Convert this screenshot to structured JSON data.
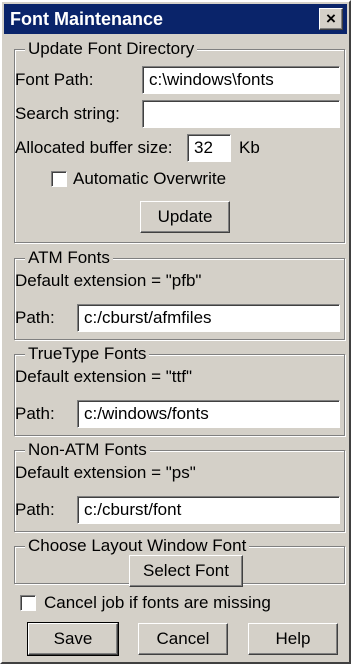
{
  "window": {
    "title": "Font Maintenance",
    "close_label": "×"
  },
  "update_group": {
    "legend": "Update Font Directory",
    "font_path_label": "Font Path:",
    "font_path_value": "c:\\windows\\fonts",
    "search_label": "Search string:",
    "search_value": "",
    "buffer_label": "Allocated buffer size:",
    "buffer_value": "32",
    "buffer_unit": "Kb",
    "auto_overwrite_label": "Automatic Overwrite",
    "auto_overwrite_checked": false,
    "update_button": "Update"
  },
  "atm_group": {
    "legend": "ATM Fonts",
    "default_ext": "Default extension = \"pfb\"",
    "path_label": "Path:",
    "path_value": "c:/cburst/afmfiles"
  },
  "truetype_group": {
    "legend": "TrueType Fonts",
    "default_ext": "Default extension = \"ttf\"",
    "path_label": "Path:",
    "path_value": "c:/windows/fonts"
  },
  "nonatm_group": {
    "legend": "Non-ATM Fonts",
    "default_ext": "Default extension = \"ps\"",
    "path_label": "Path:",
    "path_value": "c:/cburst/font"
  },
  "layout_font_group": {
    "legend": "Choose Layout Window Font",
    "select_button": "Select Font"
  },
  "cancel_missing": {
    "label": "Cancel job if fonts are missing",
    "checked": false
  },
  "buttons": {
    "save": "Save",
    "cancel": "Cancel",
    "help": "Help"
  }
}
